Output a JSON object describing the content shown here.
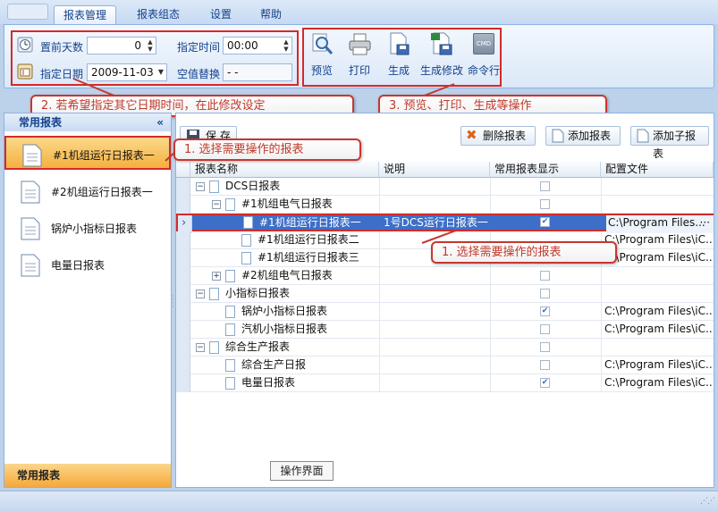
{
  "tabs": [
    "报表管理",
    "报表组态",
    "设置",
    "帮助"
  ],
  "ribbon": {
    "offset_days_label": "置前天数",
    "offset_days_value": "0",
    "date_label": "指定日期",
    "date_value": "2009-11-03",
    "time_label": "指定时间",
    "time_value": "00:00",
    "null_replace_label": "空值替换",
    "null_replace_value": "- -",
    "buttons": [
      "预览",
      "打印",
      "生成",
      "生成修改",
      "命令行"
    ],
    "cmd_badge": "CMD"
  },
  "callouts": {
    "date_hint": "2. 若希望指定其它日期时间，在此修改设定",
    "actions_hint": "3. 预览、打印、生成等操作",
    "select_hint_left": "1. 选择需要操作的报表",
    "select_hint_right": "1. 选择需要操作的报表"
  },
  "left_panel": {
    "header": "常用报表",
    "collapse_symbol": "«",
    "items": [
      "#1机组运行日报表一",
      "#2机组运行日报表一",
      "锅炉小指标日报表",
      "电量日报表"
    ],
    "selected_index": 0,
    "footer": "常用报表"
  },
  "toolbar": {
    "save_label": "保 存",
    "delete_label": "删除报表",
    "add_label": "添加报表",
    "add_child_label": "添加子报表"
  },
  "table": {
    "columns": [
      "报表名称",
      "说明",
      "常用报表显示",
      "配置文件"
    ],
    "rows": [
      {
        "name": "DCS日报表",
        "desc": "",
        "checked": false,
        "config": ""
      },
      {
        "name": "#1机组电气日报表",
        "desc": "",
        "checked": false,
        "config": ""
      },
      {
        "name": "#1机组运行日报表一",
        "desc": "1号DCS运行日报表一",
        "checked": true,
        "config": "C:\\Program Files..."
      },
      {
        "name": "#1机组运行日报表二",
        "desc": "",
        "checked": false,
        "config": "C:\\Program Files\\iC..."
      },
      {
        "name": "#1机组运行日报表三",
        "desc": "",
        "checked": false,
        "config": "C:\\Program Files\\iC..."
      },
      {
        "name": "#2机组电气日报表",
        "desc": "",
        "checked": false,
        "config": ""
      },
      {
        "name": "小指标日报表",
        "desc": "",
        "checked": false,
        "config": ""
      },
      {
        "name": "锅炉小指标日报表",
        "desc": "",
        "checked": true,
        "config": "C:\\Program Files\\iC..."
      },
      {
        "name": "汽机小指标日报表",
        "desc": "",
        "checked": false,
        "config": "C:\\Program Files\\iC..."
      },
      {
        "name": "综合生产报表",
        "desc": "",
        "checked": false,
        "config": ""
      },
      {
        "name": "综合生产日报",
        "desc": "",
        "checked": false,
        "config": "C:\\Program Files\\iC..."
      },
      {
        "name": "电量日报表",
        "desc": "",
        "checked": true,
        "config": "C:\\Program Files\\iC..."
      }
    ],
    "ellipsis": "···",
    "row_pointer": "›"
  },
  "caption": "操作界面",
  "colors": {
    "accent": "#15428b",
    "highlight_red": "#d42a2a",
    "selection_blue": "#3d6fc8",
    "orange": "#f5b040"
  }
}
